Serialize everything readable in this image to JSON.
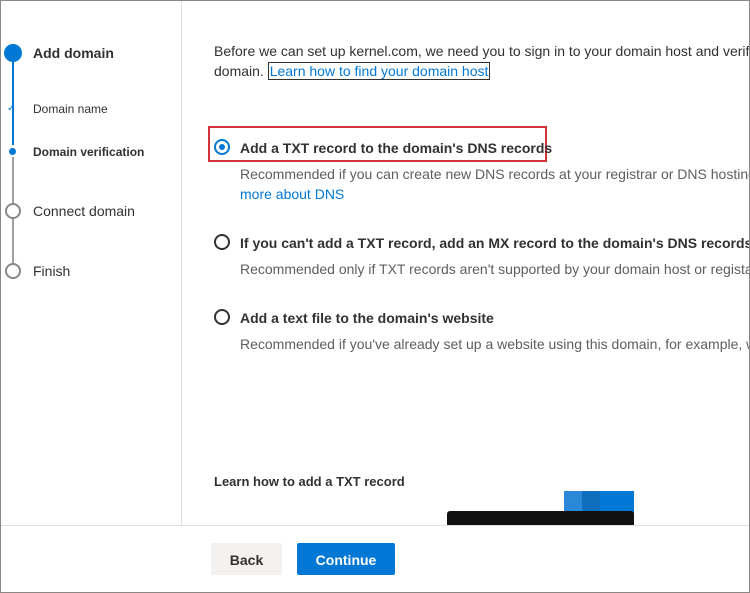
{
  "stepper": {
    "steps": [
      {
        "label": "Add domain",
        "state": "current-parent"
      },
      {
        "label": "Domain name",
        "state": "completed"
      },
      {
        "label": "Domain verification",
        "state": "current"
      },
      {
        "label": "Connect domain",
        "state": "pending"
      },
      {
        "label": "Finish",
        "state": "pending"
      }
    ]
  },
  "main": {
    "intro_text": "Before we can set up kernel.com, we need you to sign in to your domain host and verify",
    "intro_text_2": "domain.",
    "intro_link": "Learn how to find your domain host",
    "options": [
      {
        "title": "Add a TXT record to the domain's DNS records",
        "desc": "Recommended if you can create new DNS records at your registrar or DNS hosting",
        "desc_link": "more about DNS",
        "selected": true
      },
      {
        "title": "If you can't add a TXT record, add an MX record to the domain's DNS records",
        "desc": "Recommended only if TXT records aren't supported by your domain host or regista",
        "selected": false
      },
      {
        "title": "Add a text file to the domain's website",
        "desc": "Recommended if you've already set up a website using this domain, for example, w",
        "selected": false
      }
    ],
    "learn_heading": "Learn how to add a TXT record"
  },
  "footer": {
    "back_label": "Back",
    "continue_label": "Continue"
  },
  "colors": {
    "accent": "#0078d4",
    "highlight": "#d13438"
  }
}
